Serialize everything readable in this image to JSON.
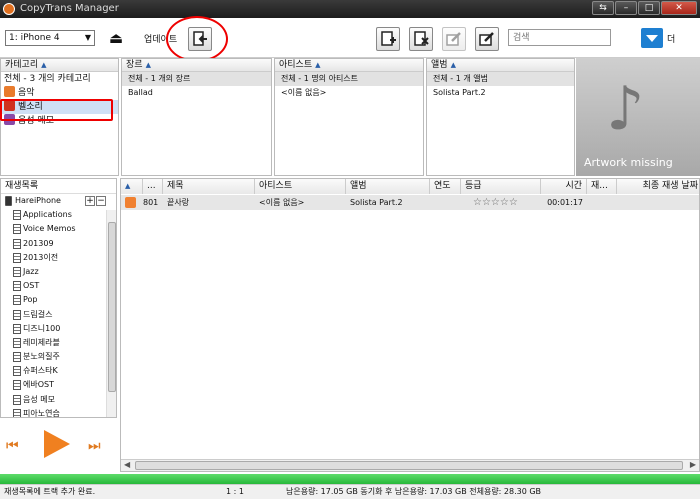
{
  "window": {
    "title": "CopyTrans Manager",
    "controls": [
      "⇆",
      "–",
      "□",
      "✕"
    ]
  },
  "toolbar": {
    "device": "1: iPhone 4",
    "update_label": "업데이트",
    "search_placeholder": "검색",
    "menu_label": "더",
    "buttons": [
      "add-track-icon",
      "delete-track-icon",
      "edit-icon",
      "edit-tag-icon"
    ]
  },
  "categories": {
    "header": "카테고리",
    "items": [
      {
        "label": "전체 - 3 개의 카테고리",
        "color": ""
      },
      {
        "label": "음악",
        "color": "#e97b2c"
      },
      {
        "label": "벨소리",
        "color": "#d03020"
      },
      {
        "label": "음성 메모",
        "color": "#8a4aa8"
      }
    ]
  },
  "genre": {
    "header": "장르",
    "items": [
      "전체 - 1 개의 장르",
      "Ballad"
    ]
  },
  "artist": {
    "header": "아티스트",
    "items": [
      "전체 - 1 명의 아티스트",
      "<이름 없음>"
    ]
  },
  "album": {
    "header": "앨범",
    "items": [
      "전체 - 1 개 앨범",
      "Solista Part.2"
    ]
  },
  "artwork": {
    "missing_text": "Artwork missing"
  },
  "playlists": {
    "header": "재생목록",
    "root": "HareiPhone",
    "add_symbols": [
      "+",
      "−"
    ],
    "items": [
      "Applications",
      "Voice Memos",
      "201309",
      "2013이전",
      "Jazz",
      "OST",
      "Pop",
      "드림걸스",
      "디즈니100",
      "레미제라블",
      "분노의질주",
      "슈퍼스타K",
      "에바OST",
      "음성 메모",
      "피아노연습"
    ]
  },
  "player": {
    "prev": "⏮",
    "next": "⏭"
  },
  "tracks": {
    "headers": [
      "...",
      "제목",
      "아티스트",
      "앨범",
      "연도",
      "등급",
      "시간",
      "재...",
      "최종 재생 날짜"
    ],
    "rows": [
      {
        "num": "801",
        "title": "끝사랑",
        "artist": "<이름 없음>",
        "album": "Solista Part.2",
        "year": "",
        "rating": "☆☆☆☆☆",
        "time": "00:01:17"
      }
    ]
  },
  "status": {
    "message": "재생목록에 트랙 추가 완료.",
    "ratio": "1 : 1",
    "space": "남은용량: 17.05 GB  동기화 후 남은용량: 17.03 GB  전체용량: 28.30 GB"
  }
}
